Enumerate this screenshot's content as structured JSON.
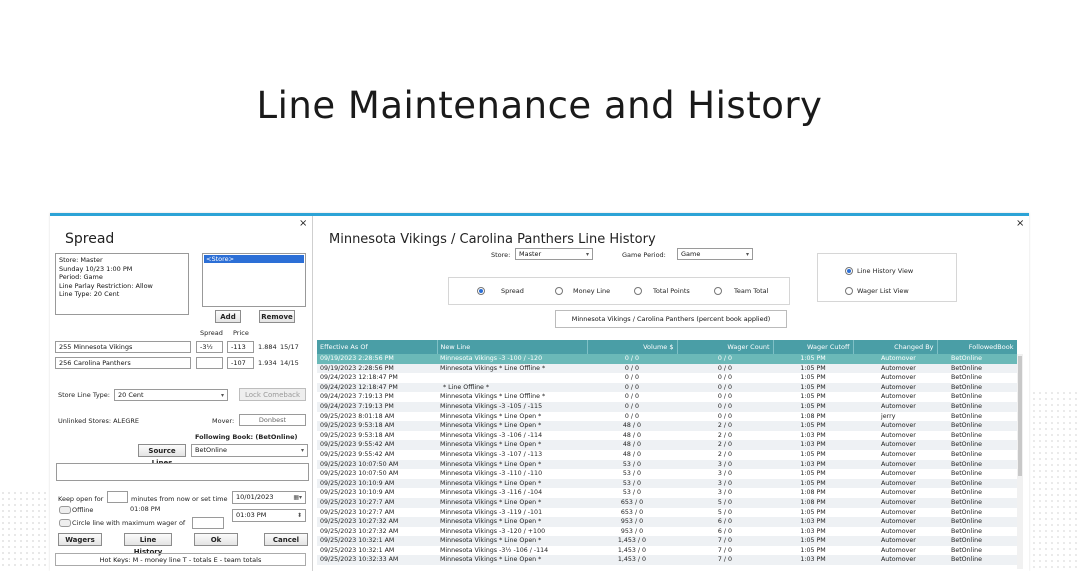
{
  "page_title": "Line Maintenance and History",
  "left_dialog": {
    "title": "Spread",
    "close": "×",
    "info_lines": [
      "Store: Master",
      "Sunday 10/23 1:00 PM",
      "Period: Game",
      "Line Parlay Restriction: Allow",
      "Line Type: 20 Cent"
    ],
    "store_list_selected": "<Store>",
    "add_label": "Add",
    "remove_label": "Remove",
    "spread_header": "Spread",
    "price_header": "Price",
    "teams": [
      {
        "name": "255 Minnesota Vikings",
        "spread": "-3½",
        "price": "-113",
        "decimal": "1.884",
        "ratio": "15/17"
      },
      {
        "name": "256 Carolina Panthers",
        "spread": "",
        "price": "-107",
        "decimal": "1.934",
        "ratio": "14/15"
      }
    ],
    "store_line_type_label": "Store Line Type:",
    "store_line_type_value": "20 Cent",
    "lock_comeback_label": "Lock Comeback",
    "unlinked_stores": "Unlinked Stores: ALEGRE",
    "mover_label": "Mover:",
    "mover_value": "Donbest",
    "following_book_label": "Following Book: (BetOnline)",
    "source_lines_label": "Source Lines",
    "following_book_value": "BetOnline",
    "keep_open_label": "Keep open for",
    "minutes_label": "minutes from now or set time",
    "time_now": "01:08 PM",
    "date_value": "10/01/2023",
    "time_value": "01:03 PM",
    "offline_label": "Offline",
    "circle_label": "Circle line with maximum wager of",
    "wagers_label": "Wagers",
    "line_history_label": "Line History",
    "ok_label": "Ok",
    "cancel_label": "Cancel",
    "hotkeys": "Hot Keys:   M - money line   T - totals    E - team totals"
  },
  "history": {
    "title": "Minnesota Vikings / Carolina Panthers Line History",
    "close": "×",
    "store_label": "Store:",
    "store_value": "Master",
    "game_period_label": "Game Period:",
    "game_period_value": "Game",
    "line_types": [
      "Spread",
      "Money Line",
      "Total Points",
      "Team Total"
    ],
    "view_options": [
      "Line History View",
      "Wager List View"
    ],
    "matchup": "Minnesota Vikings / Carolina Panthers  (percent book applied)",
    "columns": [
      "Effective As Of",
      "New Line",
      "Volume $",
      "Wager Count",
      "Wager Cutoff",
      "Changed By",
      "FollowedBook"
    ],
    "rows": [
      [
        "09/19/2023 2:28:56 PM",
        "Minnesota Vikings -3 -100 / -120",
        "0 / 0",
        "0 / 0",
        "1:05 PM",
        "Automover",
        "BetOnline"
      ],
      [
        "09/19/2023 2:28:56 PM",
        "Minnesota Vikings * Line Offline *",
        "0 / 0",
        "0 / 0",
        "1:05 PM",
        "Automover",
        "BetOnline"
      ],
      [
        "09/24/2023 12:18:47 PM",
        "",
        "0 / 0",
        "0 / 0",
        "1:05 PM",
        "Automover",
        "BetOnline"
      ],
      [
        "09/24/2023 12:18:47 PM",
        "* Line Offline *",
        "0 / 0",
        "0 / 0",
        "1:05 PM",
        "Automover",
        "BetOnline"
      ],
      [
        "09/24/2023 7:19:13 PM",
        "Minnesota Vikings * Line Offline *",
        "0 / 0",
        "0 / 0",
        "1:05 PM",
        "Automover",
        "BetOnline"
      ],
      [
        "09/24/2023 7:19:13 PM",
        "Minnesota Vikings -3 -105 / -115",
        "0 / 0",
        "0 / 0",
        "1:05 PM",
        "Automover",
        "BetOnline"
      ],
      [
        "09/25/2023 8:01:18 AM",
        "Minnesota Vikings * Line Open *",
        "0 / 0",
        "0 / 0",
        "1:08 PM",
        "jerry",
        "BetOnline"
      ],
      [
        "09/25/2023 9:53:18 AM",
        "Minnesota Vikings * Line Open *",
        "48 / 0",
        "2 / 0",
        "1:05 PM",
        "Automover",
        "BetOnline"
      ],
      [
        "09/25/2023 9:53:18 AM",
        "Minnesota Vikings -3 -106 / -114",
        "48 / 0",
        "2 / 0",
        "1:03 PM",
        "Automover",
        "BetOnline"
      ],
      [
        "09/25/2023 9:55:42 AM",
        "Minnesota Vikings * Line Open *",
        "48 / 0",
        "2 / 0",
        "1:03 PM",
        "Automover",
        "BetOnline"
      ],
      [
        "09/25/2023 9:55:42 AM",
        "Minnesota Vikings -3 -107 / -113",
        "48 / 0",
        "2 / 0",
        "1:05 PM",
        "Automover",
        "BetOnline"
      ],
      [
        "09/25/2023 10:07:50 AM",
        "Minnesota Vikings * Line Open *",
        "53 / 0",
        "3 / 0",
        "1:03 PM",
        "Automover",
        "BetOnline"
      ],
      [
        "09/25/2023 10:07:50 AM",
        "Minnesota Vikings -3 -110 / -110",
        "53 / 0",
        "3 / 0",
        "1:05 PM",
        "Automover",
        "BetOnline"
      ],
      [
        "09/25/2023 10:10:9 AM",
        "Minnesota Vikings * Line Open *",
        "53 / 0",
        "3 / 0",
        "1:05 PM",
        "Automover",
        "BetOnline"
      ],
      [
        "09/25/2023 10:10:9 AM",
        "Minnesota Vikings -3 -116 / -104",
        "53 / 0",
        "3 / 0",
        "1:08 PM",
        "Automover",
        "BetOnline"
      ],
      [
        "09/25/2023 10:27:7 AM",
        "Minnesota Vikings * Line Open *",
        "653 / 0",
        "5 / 0",
        "1:08 PM",
        "Automover",
        "BetOnline"
      ],
      [
        "09/25/2023 10:27:7 AM",
        "Minnesota Vikings -3 -119 / -101",
        "653 / 0",
        "5 / 0",
        "1:05 PM",
        "Automover",
        "BetOnline"
      ],
      [
        "09/25/2023 10:27:32 AM",
        "Minnesota Vikings * Line Open *",
        "953 / 0",
        "6 / 0",
        "1:03 PM",
        "Automover",
        "BetOnline"
      ],
      [
        "09/25/2023 10:27:32 AM",
        "Minnesota Vikings -3 -120 / +100",
        "953 / 0",
        "6 / 0",
        "1:03 PM",
        "Automover",
        "BetOnline"
      ],
      [
        "09/25/2023 10:32:1 AM",
        "Minnesota Vikings * Line Open *",
        "1,453 / 0",
        "7 / 0",
        "1:05 PM",
        "Automover",
        "BetOnline"
      ],
      [
        "09/25/2023 10:32:1 AM",
        "Minnesota Vikings -3½ -106 / -114",
        "1,453 / 0",
        "7 / 0",
        "1:05 PM",
        "Automover",
        "BetOnline"
      ],
      [
        "09/25/2023 10:32:33 AM",
        "Minnesota Vikings * Line Open *",
        "1,453 / 0",
        "7 / 0",
        "1:03 PM",
        "Automover",
        "BetOnline"
      ]
    ]
  },
  "colors": {
    "accent": "#2ca3d6",
    "grid_header": "#4a9ea6",
    "selected_row": "#6bb9b8"
  }
}
